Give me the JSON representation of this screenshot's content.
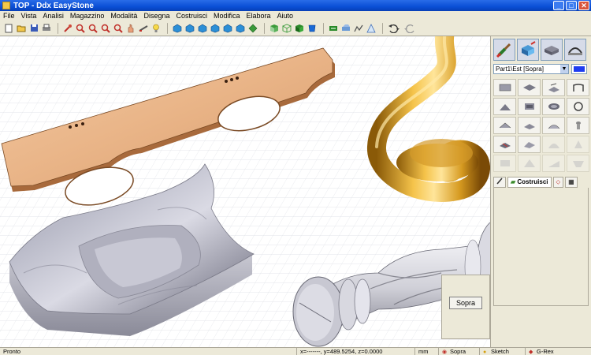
{
  "window": {
    "title": "TOP - Ddx EasyStone",
    "minimize": "_",
    "maximize": "□",
    "close": "✕"
  },
  "menu": [
    "File",
    "Vista",
    "Analisi",
    "Magazzino",
    "Modalità",
    "Disegna",
    "Costruisci",
    "Modifica",
    "Elabora",
    "Aiuto"
  ],
  "toolbar_icons": [
    "new-file-icon",
    "open-icon",
    "save-icon",
    "print-icon",
    "pan-icon",
    "zoom-in-icon",
    "zoom-out-icon",
    "zoom-window-icon",
    "zoom-all-icon",
    "hand-icon",
    "measure-icon",
    "bulb-icon",
    "view-top-icon",
    "view-front-icon",
    "view-side-icon",
    "view-iso-icon",
    "view-back-icon",
    "view-bottom-icon",
    "render-icon",
    "navigate-icon",
    "shade-icon",
    "wire-icon",
    "shaded-icon",
    "machine-icon",
    "tool-icon",
    "path-icon",
    "sim-icon",
    "undo-icon",
    "redo-icon"
  ],
  "panel": {
    "part_select": "Part1\\Est [Sopra]",
    "accent_color": "#1e3cf0",
    "tabs": [
      "Costruisci"
    ]
  },
  "view_button": "Sopra",
  "status": {
    "ready": "Pronto",
    "coords": "x=-------, y=489.5254, z=0.0000",
    "units": "mm",
    "view": "Sopra",
    "mode": "Sketch",
    "snap": "G-Rex"
  }
}
